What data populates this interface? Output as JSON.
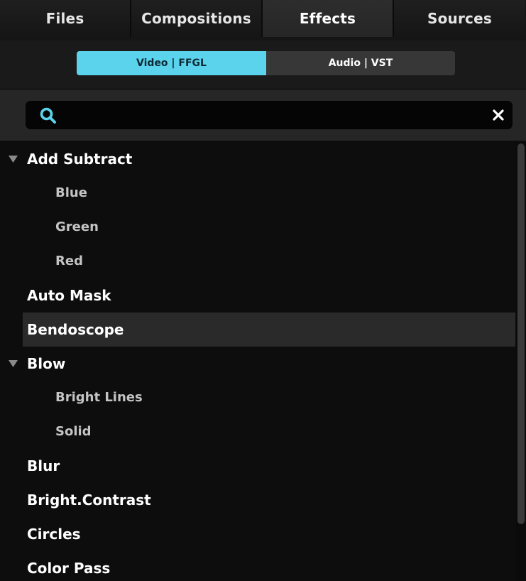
{
  "tabs": [
    {
      "label": "Files",
      "active": false
    },
    {
      "label": "Compositions",
      "active": false
    },
    {
      "label": "Effects",
      "active": true
    },
    {
      "label": "Sources",
      "active": false
    }
  ],
  "filter": {
    "video_label": "Video | FFGL",
    "audio_label": "Audio | VST",
    "selected": "Video | FFGL"
  },
  "search": {
    "value": "",
    "placeholder": ""
  },
  "list": {
    "items": [
      {
        "label": "Add Subtract",
        "kind": "group",
        "expanded": true
      },
      {
        "label": "Blue",
        "kind": "child"
      },
      {
        "label": "Green",
        "kind": "child"
      },
      {
        "label": "Red",
        "kind": "child"
      },
      {
        "label": "Auto Mask",
        "kind": "item"
      },
      {
        "label": "Bendoscope",
        "kind": "item",
        "selected": true
      },
      {
        "label": "Blow",
        "kind": "group",
        "expanded": true
      },
      {
        "label": "Bright Lines",
        "kind": "child"
      },
      {
        "label": "Solid",
        "kind": "child"
      },
      {
        "label": "Blur",
        "kind": "item"
      },
      {
        "label": "Bright.Contrast",
        "kind": "item"
      },
      {
        "label": "Circles",
        "kind": "item"
      },
      {
        "label": "Color Pass",
        "kind": "item"
      }
    ]
  },
  "colors": {
    "accent": "#5cd3ec",
    "background": "#0d0d0d",
    "selected_row": "#2a2a2a"
  },
  "icons": {
    "search": "search-icon",
    "clear": "close-icon",
    "disclosure": "triangle-down-icon"
  }
}
